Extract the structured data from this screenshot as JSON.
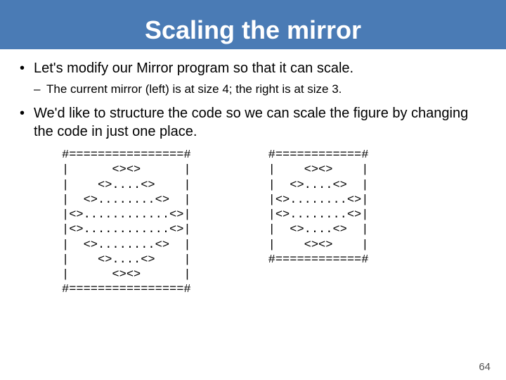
{
  "title": "Scaling the mirror",
  "bullets": {
    "b1": "Let's modify our Mirror program so that it can scale.",
    "b1_sub": "The current mirror (left) is at size 4; the right is at size 3.",
    "b2": "We'd like to structure the code so we can scale the figure by changing the code in just one place."
  },
  "figures": {
    "left": "#================#\n|      <><>      |\n|    <>....<>    |\n|  <>........<>  |\n|<>............<>|\n|<>............<>|\n|  <>........<>  |\n|    <>....<>    |\n|      <><>      |\n#================#",
    "right": "#============#\n|    <><>    |\n|  <>....<>  |\n|<>........<>|\n|<>........<>|\n|  <>....<>  |\n|    <><>    |\n#============#"
  },
  "page_number": "64"
}
